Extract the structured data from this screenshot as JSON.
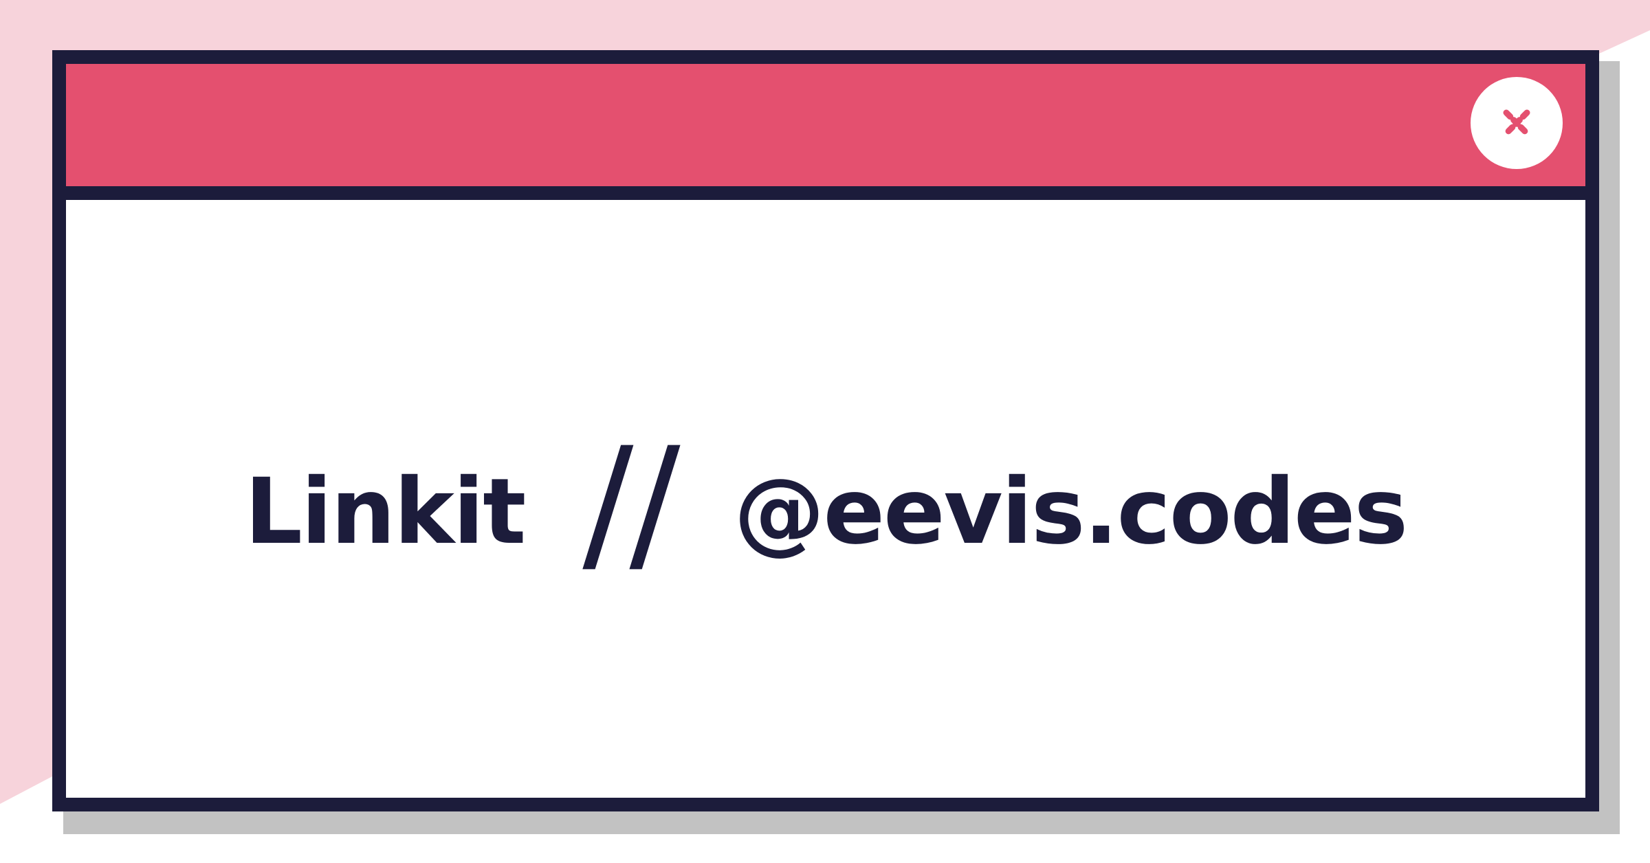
{
  "window": {
    "title_bar_color": "#e4506f",
    "frame_color": "#1c1c3b",
    "close_icon": "close-icon"
  },
  "heading": {
    "name": "Linkit",
    "separator": "//",
    "handle": "@eevis.codes"
  },
  "colors": {
    "accent": "#e4506f",
    "text": "#1c1c3b",
    "background_shape": "#f7d3db",
    "shadow": "#c2c2c2"
  }
}
